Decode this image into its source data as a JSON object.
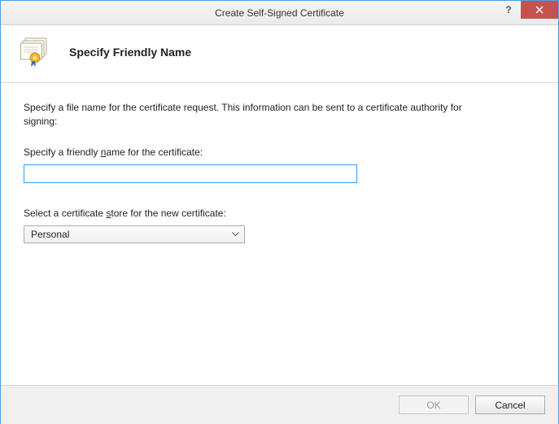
{
  "titlebar": {
    "title": "Create Self-Signed Certificate",
    "help_symbol": "?"
  },
  "header": {
    "heading": "Specify Friendly Name"
  },
  "content": {
    "intro": "Specify a file name for the certificate request.  This information can be sent to a certificate authority for signing:",
    "friendly_name_label_pre": "Specify a friendly ",
    "friendly_name_label_accel": "n",
    "friendly_name_label_post": "ame for the certificate:",
    "friendly_name_value": "",
    "store_label_pre": "Select a certificate ",
    "store_label_accel": "s",
    "store_label_post": "tore for the new certificate:",
    "store_selected": "Personal"
  },
  "footer": {
    "ok_label": "OK",
    "cancel_label": "Cancel"
  }
}
